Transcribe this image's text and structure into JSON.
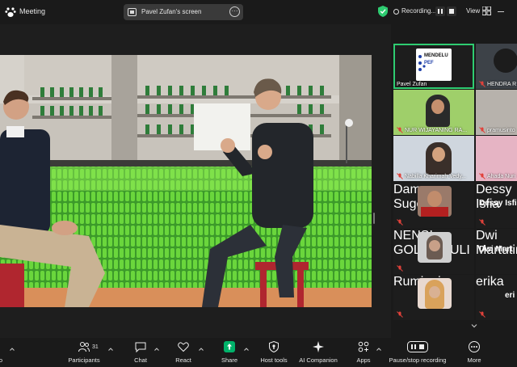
{
  "window": {
    "title": "Meeting"
  },
  "share": {
    "label": "Pavel Zufan's screen"
  },
  "recording": {
    "label": "Recording..."
  },
  "view": {
    "label": "View"
  },
  "participants_panel": {
    "tiles": [
      {
        "name": "Pavel Zufan",
        "logo_lines": [
          "MENDELU",
          "PEF"
        ],
        "active": true
      },
      {
        "name": "HENDRA R",
        "muted": true
      },
      {
        "name": "NUR WIJAYANING RA...",
        "muted": true
      },
      {
        "name": "pramusinto",
        "muted": true
      },
      {
        "name": "Nabilla Kharimah Vedy...",
        "muted": true
      },
      {
        "name": "Ahada Nuri",
        "muted": true
      }
    ],
    "avatars": [
      {
        "name": "Damar Sugeng",
        "muted": true
      },
      {
        "name": "NENSI GOLDA YULI",
        "muted": true
      },
      {
        "name": "Rumiani",
        "muted": true
      }
    ],
    "names_only": [
      {
        "big": "Dessy Isfi",
        "small": "Dessy Isfia",
        "muted": true
      },
      {
        "big": "Dwi Mart",
        "small": "Dwi Martutin",
        "muted": false
      },
      {
        "big": "eri",
        "small": "erika",
        "muted": true
      }
    ]
  },
  "toolbar": {
    "participants_count": "31",
    "items": [
      {
        "label": "o"
      },
      {
        "label": "Participants"
      },
      {
        "label": "Chat"
      },
      {
        "label": "React"
      },
      {
        "label": "Share"
      },
      {
        "label": "Host tools"
      },
      {
        "label": "AI Companion"
      },
      {
        "label": "Apps"
      },
      {
        "label": "Pause/stop recording"
      },
      {
        "label": "More"
      }
    ]
  },
  "colors": {
    "active_green": "#2ecc71",
    "share_green": "#00b26a",
    "mute_red": "#e0413a",
    "bar_bg": "#1a1a1a"
  }
}
